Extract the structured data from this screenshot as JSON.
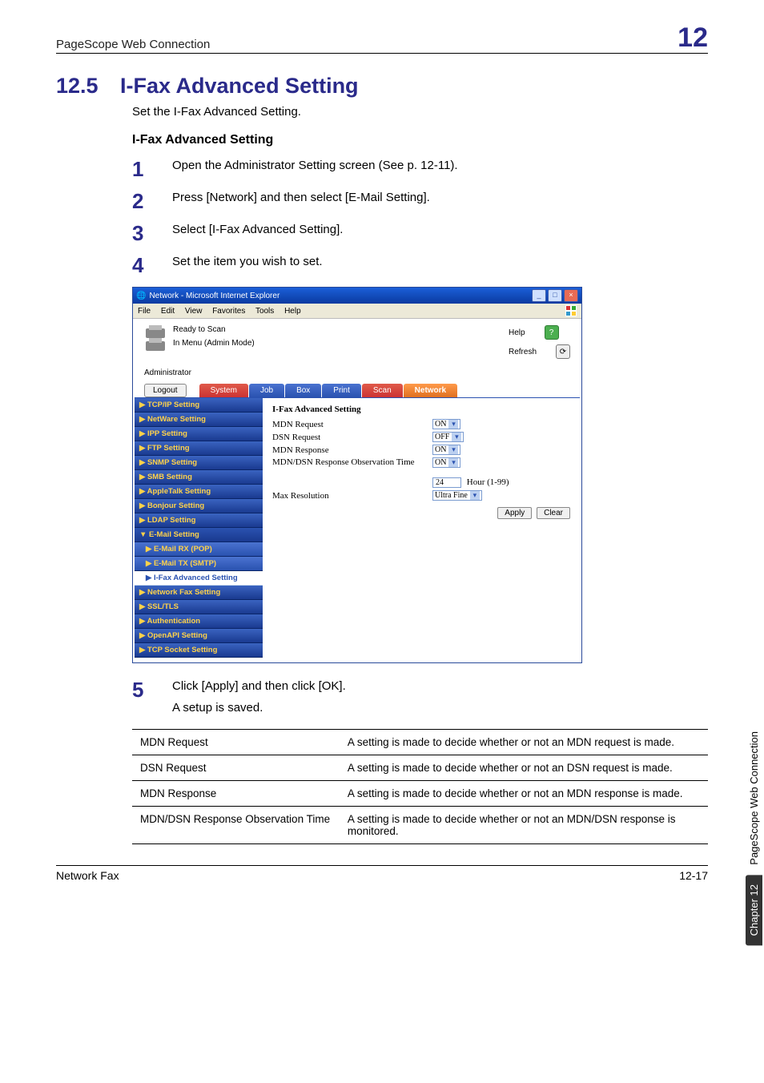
{
  "running_head": {
    "title": "PageScope Web Connection",
    "chapter_box": "12"
  },
  "section": {
    "number": "12.5",
    "title": "I-Fax Advanced Setting",
    "lead": "Set the I-Fax Advanced Setting.",
    "subhead": "I-Fax Advanced Setting"
  },
  "steps": [
    "Open the Administrator Setting screen (See p. 12-11).",
    "Press [Network] and then select [E-Mail Setting].",
    "Select [I-Fax Advanced Setting].",
    "Set the item you wish to set."
  ],
  "step_nums": [
    "1",
    "2",
    "3",
    "4",
    "5"
  ],
  "step5": {
    "text": "Click [Apply] and then click [OK].",
    "sub": "A setup is saved."
  },
  "screenshot": {
    "window_title": "Network - Microsoft Internet Explorer",
    "menus": [
      "File",
      "Edit",
      "View",
      "Favorites",
      "Tools",
      "Help"
    ],
    "status1": "Ready to Scan",
    "status2": "In Menu (Admin Mode)",
    "help": "Help",
    "refresh": "Refresh",
    "admin_label": "Administrator",
    "logout": "Logout",
    "tabs": [
      "System",
      "Job",
      "Box",
      "Print",
      "Scan",
      "Network"
    ],
    "nav": [
      {
        "label": "TCP/IP Setting",
        "sub": false,
        "active": false
      },
      {
        "label": "NetWare Setting",
        "sub": false,
        "active": false
      },
      {
        "label": "IPP Setting",
        "sub": false,
        "active": false
      },
      {
        "label": "FTP Setting",
        "sub": false,
        "active": false
      },
      {
        "label": "SNMP Setting",
        "sub": false,
        "active": false
      },
      {
        "label": "SMB Setting",
        "sub": false,
        "active": false
      },
      {
        "label": "AppleTalk Setting",
        "sub": false,
        "active": false
      },
      {
        "label": "Bonjour Setting",
        "sub": false,
        "active": false
      },
      {
        "label": "LDAP Setting",
        "sub": false,
        "active": false
      },
      {
        "label": "E-Mail Setting",
        "sub": false,
        "active": true
      },
      {
        "label": "E-Mail RX (POP)",
        "sub": true,
        "active": false
      },
      {
        "label": "E-Mail TX (SMTP)",
        "sub": true,
        "active": false
      },
      {
        "label": "I-Fax Advanced Setting",
        "sub": true,
        "active": true
      },
      {
        "label": "Network Fax Setting",
        "sub": false,
        "active": false
      },
      {
        "label": "SSL/TLS",
        "sub": false,
        "active": false
      },
      {
        "label": "Authentication",
        "sub": false,
        "active": false
      },
      {
        "label": "OpenAPI Setting",
        "sub": false,
        "active": false
      },
      {
        "label": "TCP Socket Setting",
        "sub": false,
        "active": false
      }
    ],
    "form": {
      "title": "I-Fax Advanced Setting",
      "mdn_req_label": "MDN Request",
      "mdn_req_val": "ON",
      "dsn_req_label": "DSN Request",
      "dsn_req_val": "OFF",
      "mdn_resp_label": "MDN Response",
      "mdn_resp_val": "ON",
      "mdndsn_label": "MDN/DSN Response Observation Time",
      "mdndsn_sel": "ON",
      "mdndsn_num": "24",
      "mdndsn_unit": "Hour (1-99)",
      "maxres_label": "Max Resolution",
      "maxres_val": "Ultra Fine",
      "apply": "Apply",
      "clear": "Clear"
    }
  },
  "table": {
    "rows": [
      {
        "k": "MDN Request",
        "v": "A setting is made to decide whether or not an MDN request is made."
      },
      {
        "k": "DSN Request",
        "v": "A setting is made to decide whether or not an DSN request is made."
      },
      {
        "k": "MDN Response",
        "v": "A setting is made to decide whether or not an MDN response is made."
      },
      {
        "k": "MDN/DSN Response Observation Time",
        "v": "A setting is made to decide whether or not an MDN/DSN response is monitored."
      }
    ]
  },
  "side": {
    "dark": "Chapter 12",
    "light": "PageScope Web Connection"
  },
  "footer": {
    "left": "Network Fax",
    "right": "12-17"
  }
}
